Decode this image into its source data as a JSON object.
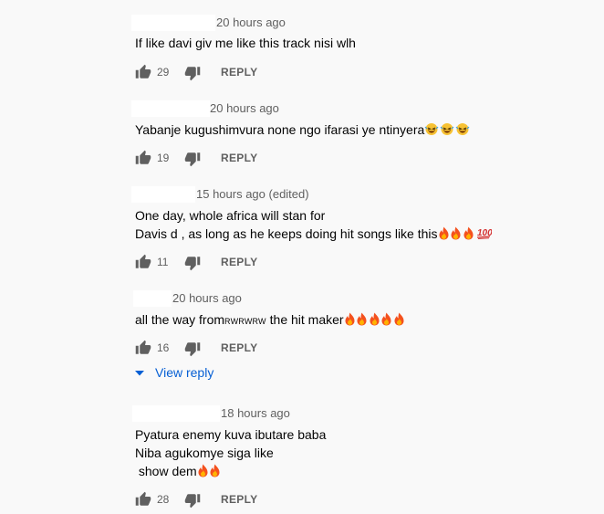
{
  "comments": [
    {
      "timestamp": "20 hours ago",
      "lines": [
        "If like davi giv me like this track nisi wlh"
      ],
      "likes": "29"
    },
    {
      "timestamp": "20 hours ago",
      "lines": [
        "Yabanje kugushimvura none ngo ifarasi ye ntinyera"
      ],
      "likes": "19"
    },
    {
      "timestamp": "15 hours ago (edited)",
      "lines": [
        "One day, whole africa will stan for",
        "Davis d , as long as he keeps doing hit songs like this"
      ],
      "likes": "11"
    },
    {
      "timestamp": "20 hours ago",
      "lines_pre": "all the way from",
      "lines_small": "RWRWRW",
      "lines_post": " the hit maker",
      "likes": "16"
    },
    {
      "timestamp": "18 hours ago",
      "lines": [
        "Pyatura enemy kuva ibutare baba",
        "Niba agukomye siga like",
        " show dem"
      ],
      "likes": "28"
    }
  ],
  "reply_label": "REPLY",
  "view_reply_label": "View reply",
  "icons": {
    "like": "thumbs-up-icon",
    "dislike": "thumbs-down-icon",
    "fire": "fire-emoji",
    "grin": "grinning-squinting-emoji",
    "hundred": "hundred-points-emoji",
    "expand": "chevron-down-icon"
  },
  "colors": {
    "background": "#f9f9f9",
    "text": "#030303",
    "meta": "#606060",
    "link": "#065fd4"
  }
}
